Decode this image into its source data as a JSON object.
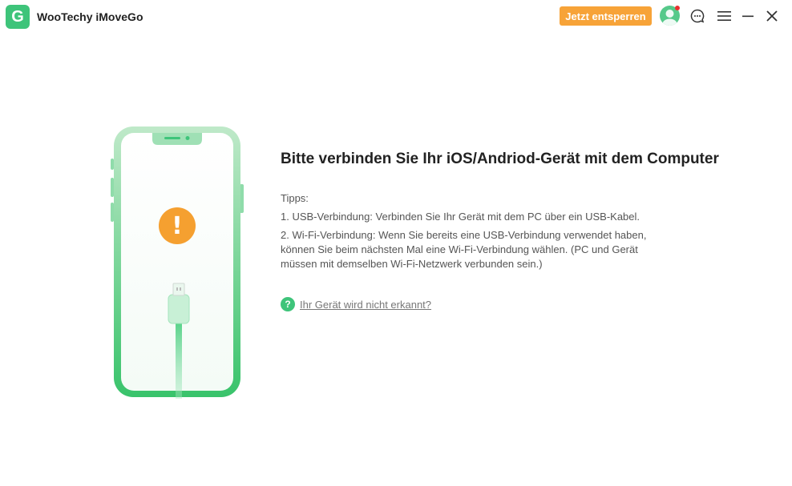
{
  "app": {
    "title": "WooTechy iMoveGo",
    "logo_letter": "G"
  },
  "toolbar": {
    "unlock_label": "Jetzt entsperren",
    "icons": [
      "avatar-icon",
      "feedback-chat-icon",
      "menu-icon",
      "minimize-icon",
      "close-icon"
    ]
  },
  "main": {
    "headline": "Bitte verbinden Sie Ihr iOS/Andriod-Gerät mit dem Computer",
    "tips_title": "Tipps:",
    "tips": [
      "1. USB-Verbindung: Verbinden Sie Ihr Gerät mit dem PC über ein USB-Kabel.",
      "2. Wi-Fi-Verbindung: Wenn Sie bereits eine USB-Verbindung verwendet haben, können Sie beim nächsten Mal eine Wi-Fi-Verbindung wählen. (PC und Gerät müssen mit demselben Wi-Fi-Netzwerk verbunden sein.)"
    ],
    "help_icon_glyph": "?",
    "help_link": "Ihr Gerät wird nicht erkannt?",
    "warning_glyph": "!"
  },
  "colors": {
    "accent_green": "#3ec47a",
    "unlock_orange": "#f7a338",
    "warning_orange": "#f5a030"
  }
}
